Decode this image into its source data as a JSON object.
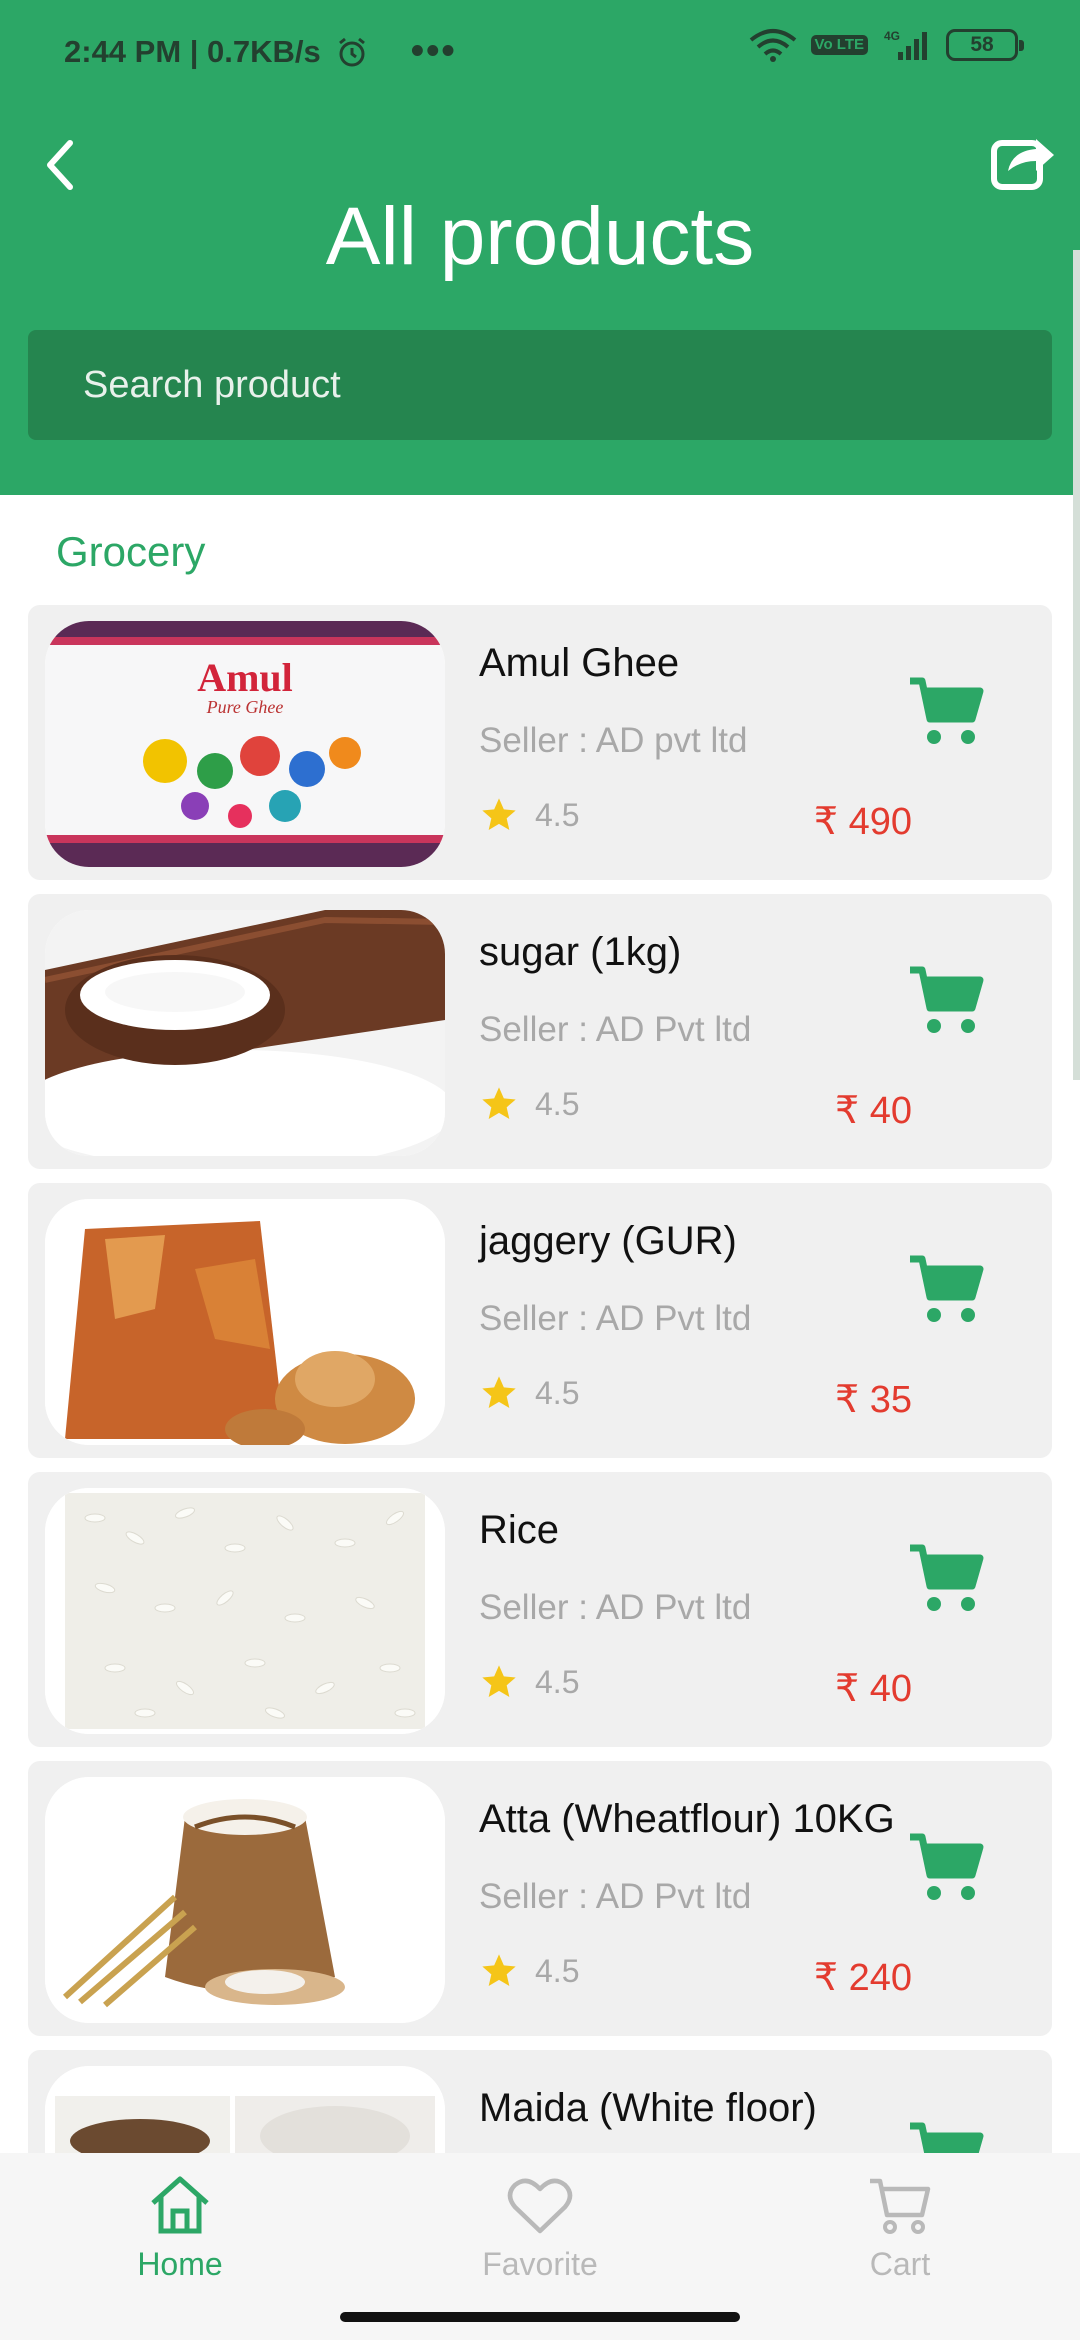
{
  "status_bar": {
    "time": "2:44 PM | 0.7KB/s",
    "battery": "58",
    "network": "4G",
    "volte": "Vo LTE"
  },
  "header": {
    "title": "All products",
    "back_icon": "chevron-left-icon",
    "share_icon": "share-icon"
  },
  "search": {
    "placeholder": "Search product"
  },
  "section": {
    "title": "Grocery"
  },
  "products": [
    {
      "name": "Amul Ghee",
      "seller": "Seller :  AD pvt ltd",
      "rating": "4.5",
      "price": "₹ 490"
    },
    {
      "name": "sugar (1kg)",
      "seller": "Seller :  AD Pvt ltd",
      "rating": "4.5",
      "price": "₹ 40"
    },
    {
      "name": "jaggery (GUR)",
      "seller": "Seller :  AD Pvt ltd",
      "rating": "4.5",
      "price": "₹ 35"
    },
    {
      "name": "Rice",
      "seller": "Seller :  AD Pvt ltd",
      "rating": "4.5",
      "price": "₹ 40"
    },
    {
      "name": "Atta (Wheatflour) 10KG",
      "seller": "Seller :  AD Pvt ltd",
      "rating": "4.5",
      "price": "₹ 240"
    },
    {
      "name": "Maida (White floor)",
      "seller": "",
      "rating": "",
      "price": ""
    }
  ],
  "product_image_text": {
    "amul_brand": "Amul",
    "amul_sub": "Pure Ghee"
  },
  "nav": {
    "home": "Home",
    "favorite": "Favorite",
    "cart": "Cart"
  },
  "colors": {
    "primary": "#2ca766",
    "primary_dark": "#25854f",
    "price": "#e33b2f",
    "star": "#f5c518"
  }
}
